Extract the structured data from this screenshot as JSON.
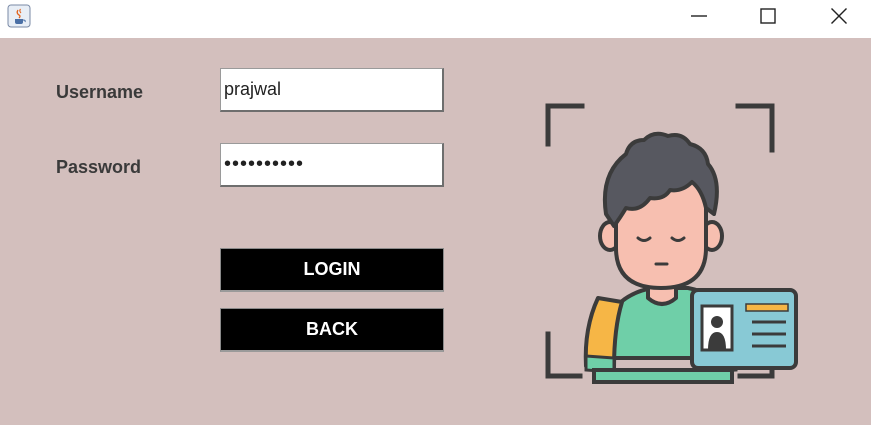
{
  "window": {
    "controls": {
      "minimize_icon": "minimize-icon",
      "maximize_icon": "maximize-icon",
      "close_icon": "close-icon"
    }
  },
  "form": {
    "username_label": "Username",
    "username_value": "prajwal",
    "password_label": "Password",
    "password_value": "••••••••••",
    "login_label": "LOGIN",
    "back_label": "BACK"
  },
  "colors": {
    "background": "#d3bfbd",
    "button": "#000000",
    "button_text": "#ffffff"
  }
}
